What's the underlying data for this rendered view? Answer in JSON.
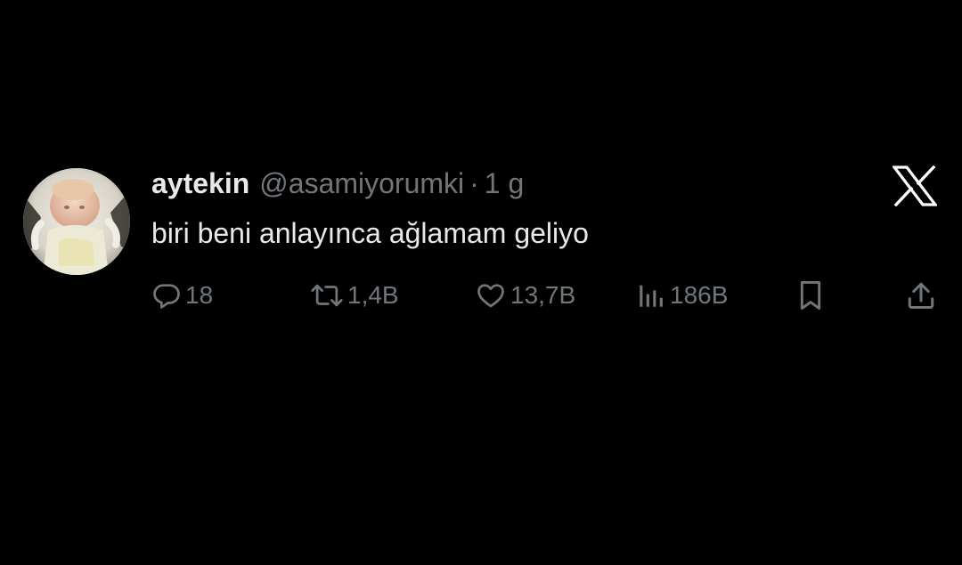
{
  "tweet": {
    "display_name": "aytekin",
    "handle": "@asamiyorumki",
    "separator": "·",
    "timestamp": "1 g",
    "text": "biri beni anlayınca ağlamam geliyo"
  },
  "actions": {
    "replies": "18",
    "reposts": "1,4B",
    "likes": "13,7B",
    "views": "186B"
  },
  "icons": {
    "brand": "x-logo-icon",
    "reply": "reply-icon",
    "repost": "repost-icon",
    "like": "heart-icon",
    "views": "views-icon",
    "bookmark": "bookmark-icon",
    "share": "share-icon"
  },
  "colors": {
    "background": "#000000",
    "primary_text": "#e7e9ea",
    "secondary_text": "#71767b"
  }
}
